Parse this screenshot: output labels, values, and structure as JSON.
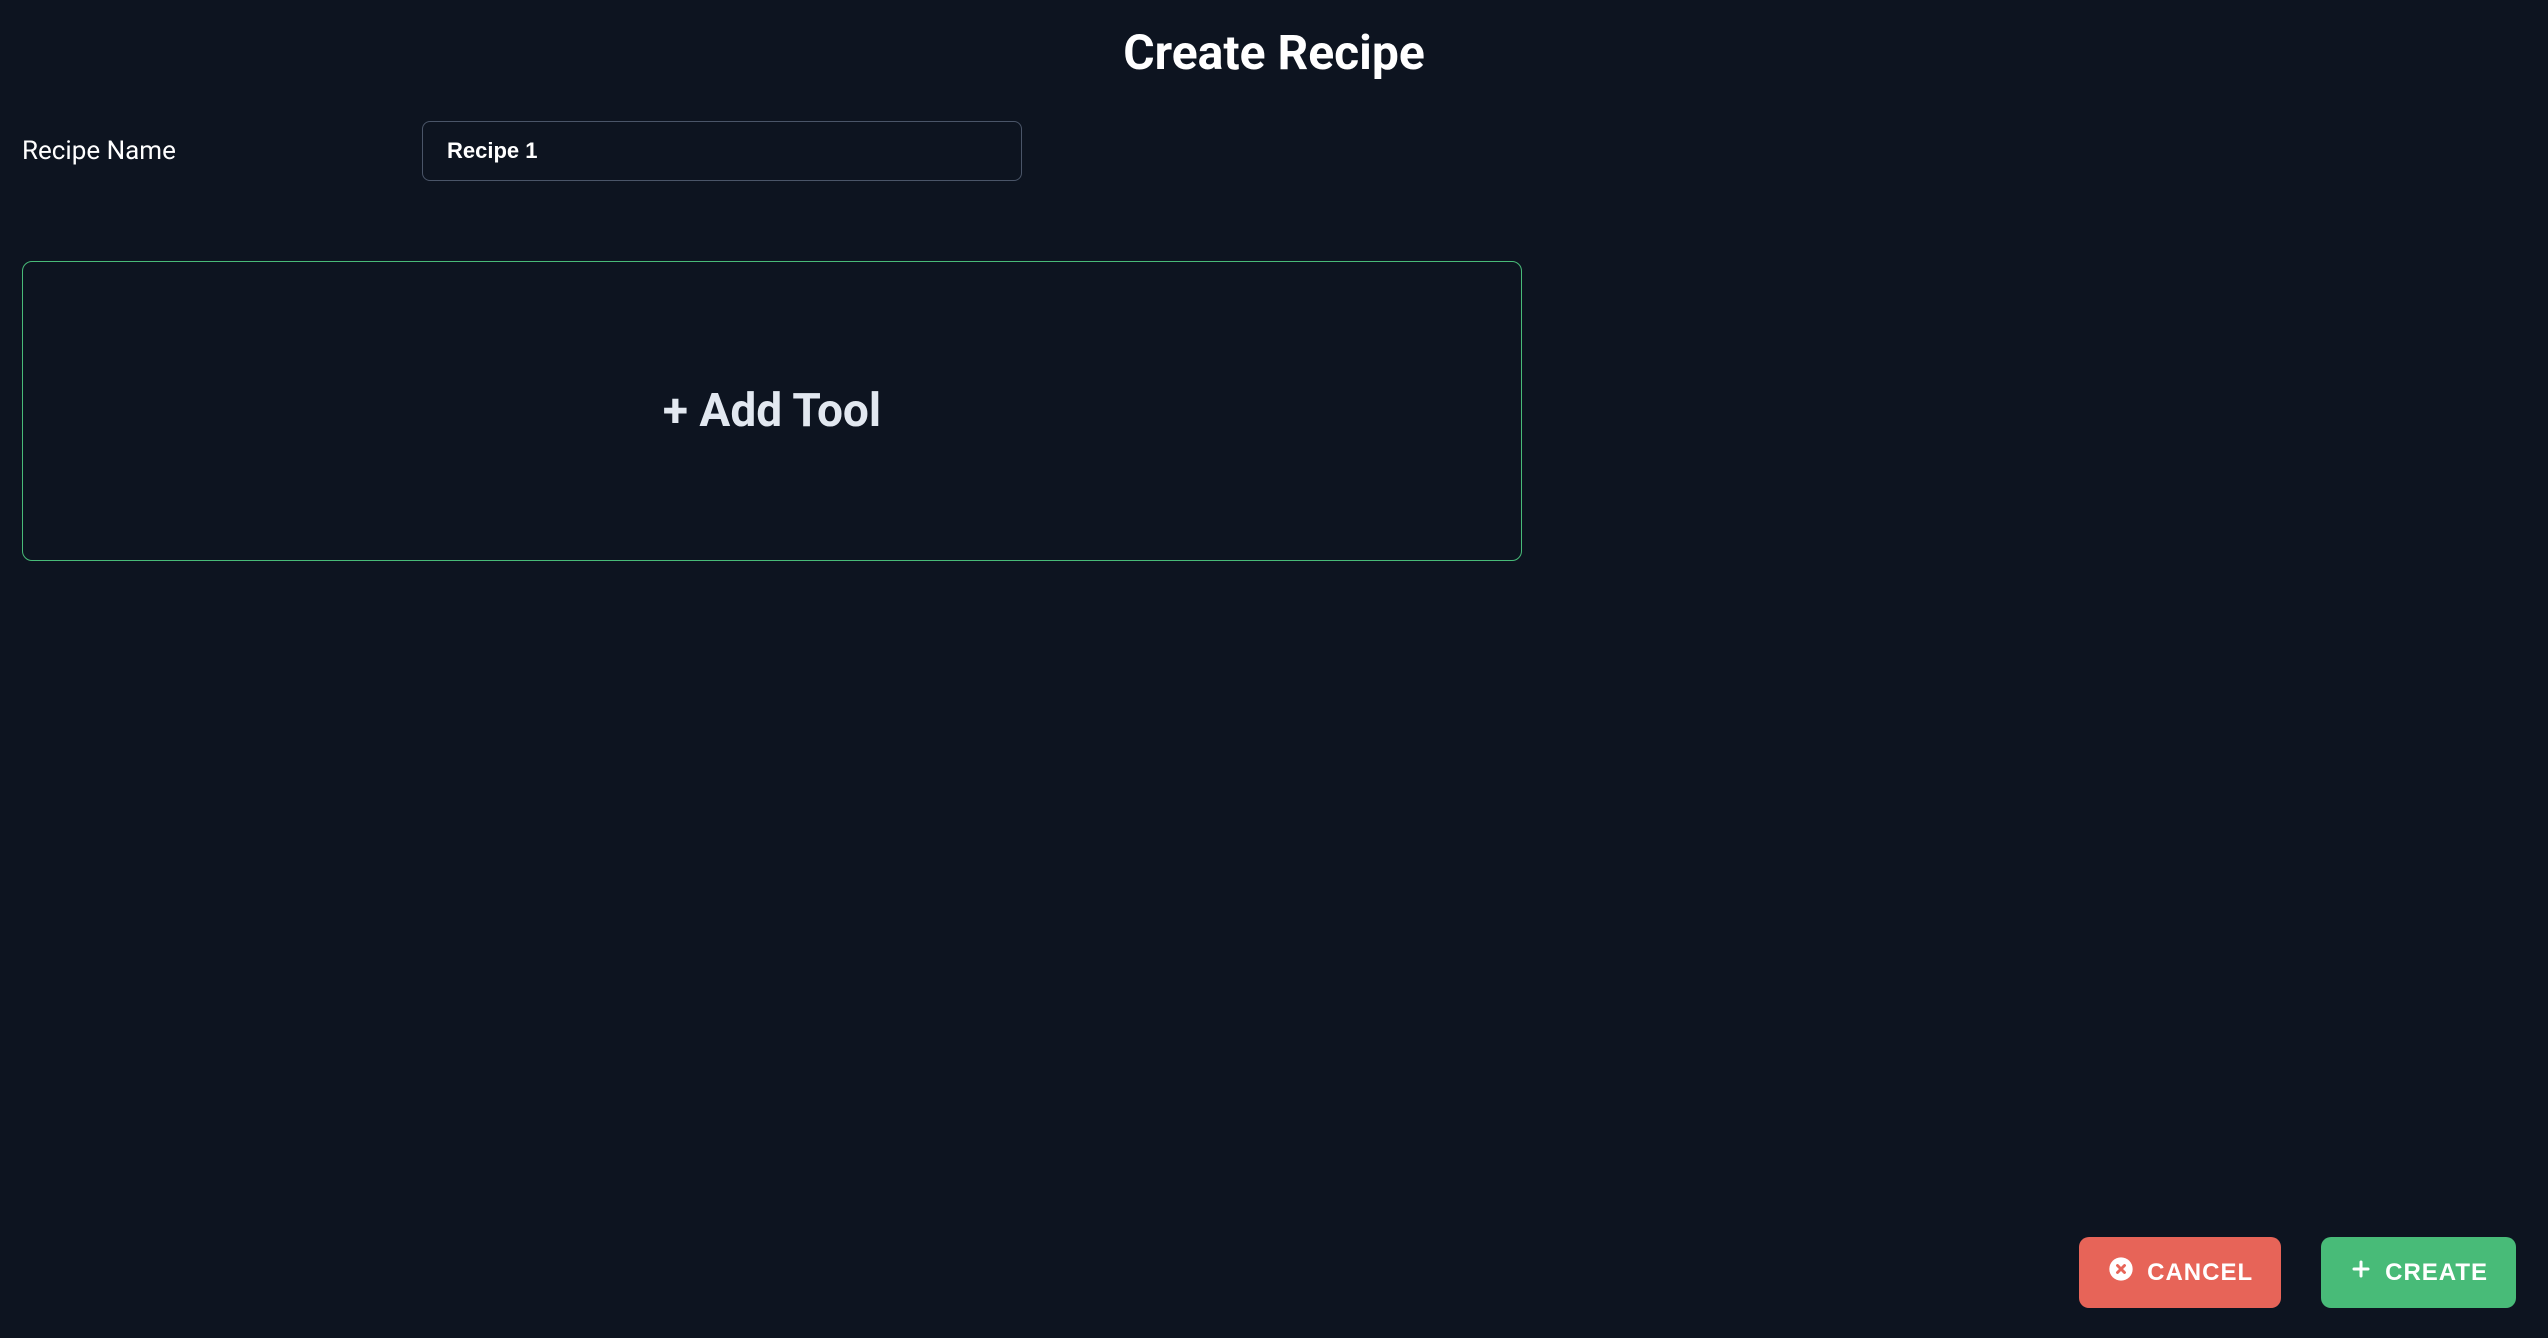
{
  "header": {
    "title": "Create Recipe"
  },
  "form": {
    "recipe_name_label": "Recipe Name",
    "recipe_name_value": "Recipe 1"
  },
  "add_tool": {
    "label": "+ Add Tool"
  },
  "actions": {
    "cancel_label": "CANCEL",
    "create_label": "CREATE"
  }
}
